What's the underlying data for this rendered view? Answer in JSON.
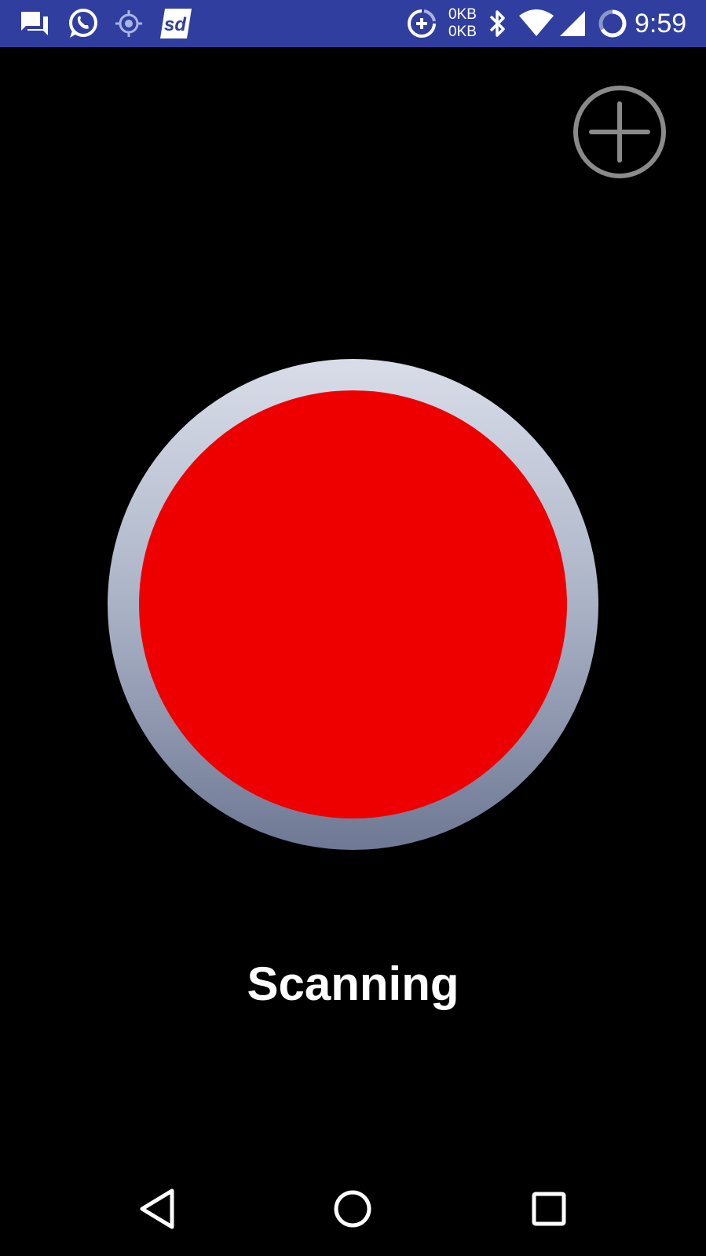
{
  "status_bar": {
    "icons_left": [
      "messages-icon",
      "whatsapp-icon",
      "location-icon",
      "sd-app-icon"
    ],
    "icons_right": [
      "data-saver-icon",
      "bluetooth-icon",
      "wifi-icon",
      "signal-icon",
      "battery-icon"
    ],
    "net_up": "0KB",
    "net_down": "0KB",
    "time": "9:59",
    "background_color": "#303F9F"
  },
  "main": {
    "add_button_icon": "add-circle-icon",
    "record_button_color": "#EE0000",
    "status_text": "Scanning"
  },
  "nav_bar": {
    "buttons": [
      "back-icon",
      "home-icon",
      "recents-icon"
    ]
  }
}
